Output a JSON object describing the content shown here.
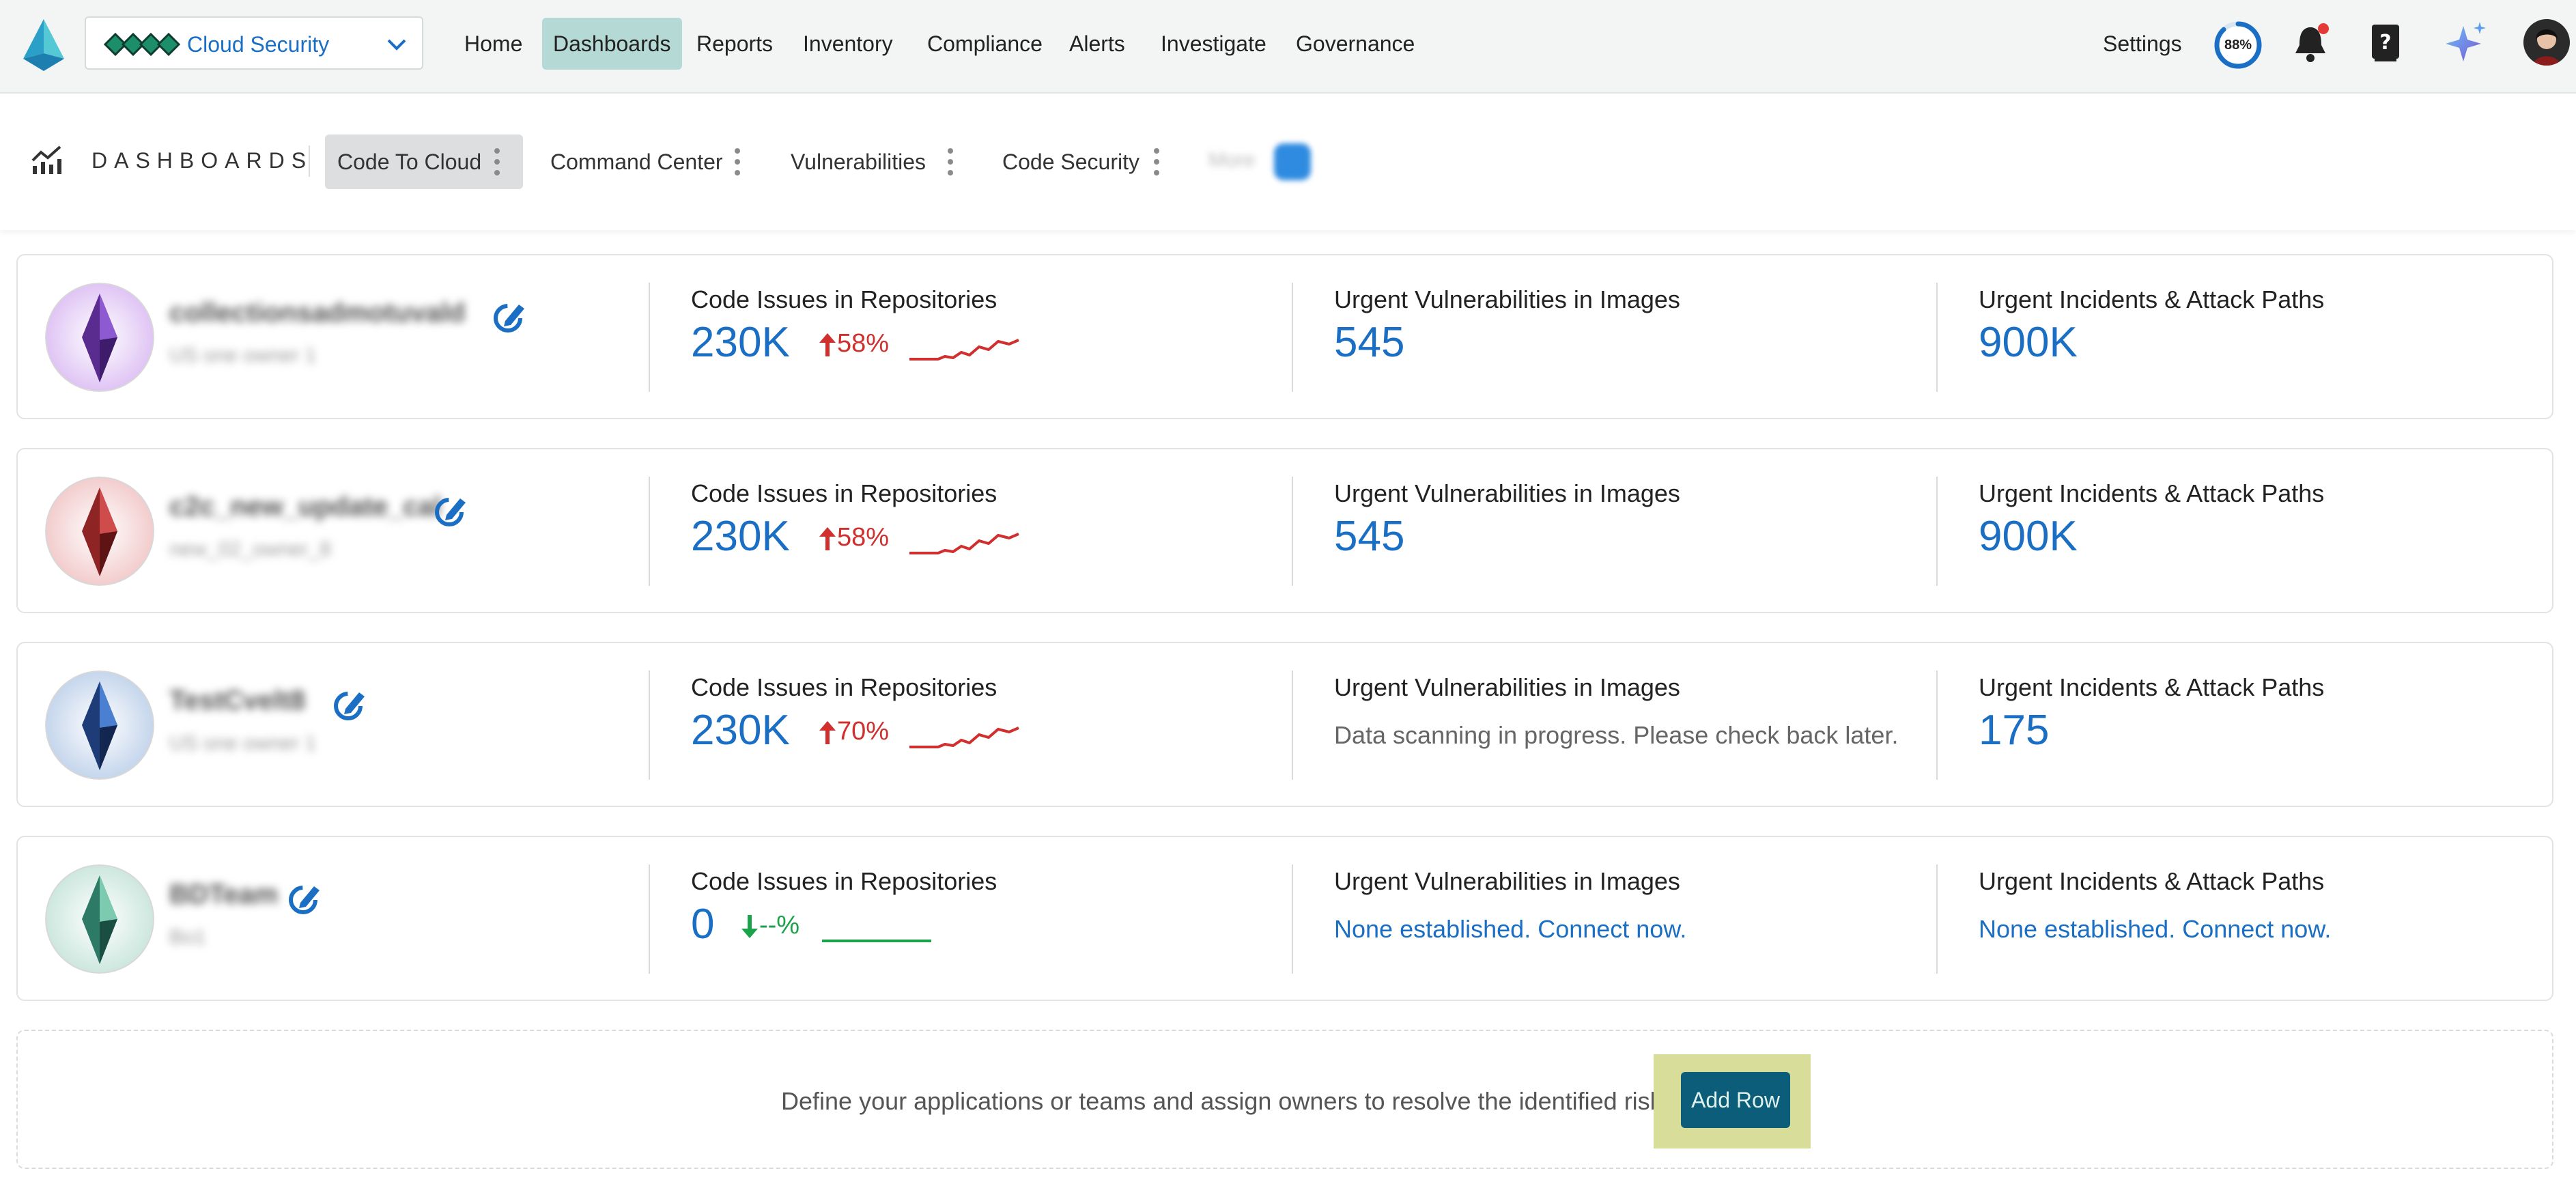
{
  "topnav": {
    "product_select": {
      "label": "Cloud Security",
      "icon": "cloud-security-diamonds-icon"
    },
    "items": [
      {
        "label": "Home",
        "active": false
      },
      {
        "label": "Dashboards",
        "active": true
      },
      {
        "label": "Reports",
        "active": false
      },
      {
        "label": "Inventory",
        "active": false
      },
      {
        "label": "Compliance",
        "active": false
      },
      {
        "label": "Alerts",
        "active": false
      },
      {
        "label": "Investigate",
        "active": false
      },
      {
        "label": "Governance",
        "active": false
      }
    ],
    "settings_label": "Settings",
    "progress": {
      "label": "88%",
      "value": 0.88
    },
    "icons": [
      "bell-icon",
      "help-book-icon",
      "sparkle-icon",
      "user-avatar"
    ],
    "notification_dot_color": "#e53935",
    "accent_color": "#1a6fc4"
  },
  "dashboards_bar": {
    "title": "DASHBOARDS",
    "tabs": [
      {
        "label": "Code To Cloud",
        "active": true
      },
      {
        "label": "Command Center",
        "active": false
      },
      {
        "label": "Vulnerabilities",
        "active": false
      },
      {
        "label": "Code Security",
        "active": false
      }
    ],
    "more_label": "More"
  },
  "metric_titles": {
    "code": "Code Issues in Repositories",
    "vuln": "Urgent Vulnerabilities in Images",
    "incidents": "Urgent Incidents & Attack Paths"
  },
  "apps": [
    {
      "name": "collectionsadmotuvald",
      "subtitle": "US one owner 1",
      "gem_color": "purple",
      "code": {
        "value": "230K",
        "trend": "58%",
        "direction": "up"
      },
      "vuln": {
        "value": "545"
      },
      "incidents": {
        "value": "900K"
      }
    },
    {
      "name": "c2c_new_update_cal",
      "subtitle": "new_02_owner_8",
      "gem_color": "red",
      "code": {
        "value": "230K",
        "trend": "58%",
        "direction": "up"
      },
      "vuln": {
        "value": "545"
      },
      "incidents": {
        "value": "900K"
      }
    },
    {
      "name": "TestCvelt8",
      "subtitle": "US one owner 1",
      "gem_color": "blue",
      "code": {
        "value": "230K",
        "trend": "70%",
        "direction": "up"
      },
      "vuln": {
        "note": "Data scanning in progress. Please check back later."
      },
      "incidents": {
        "value": "175"
      }
    },
    {
      "name": "BDTeam",
      "subtitle": "Bo1",
      "gem_color": "teal",
      "code": {
        "value": "0",
        "trend": "--%",
        "direction": "down"
      },
      "vuln": {
        "link": "None established. Connect now."
      },
      "incidents": {
        "link": "None established. Connect now."
      }
    }
  ],
  "add_row": {
    "text": "Define your applications or teams and assign owners to resolve the identified risks.",
    "button_label": "Add Row"
  }
}
